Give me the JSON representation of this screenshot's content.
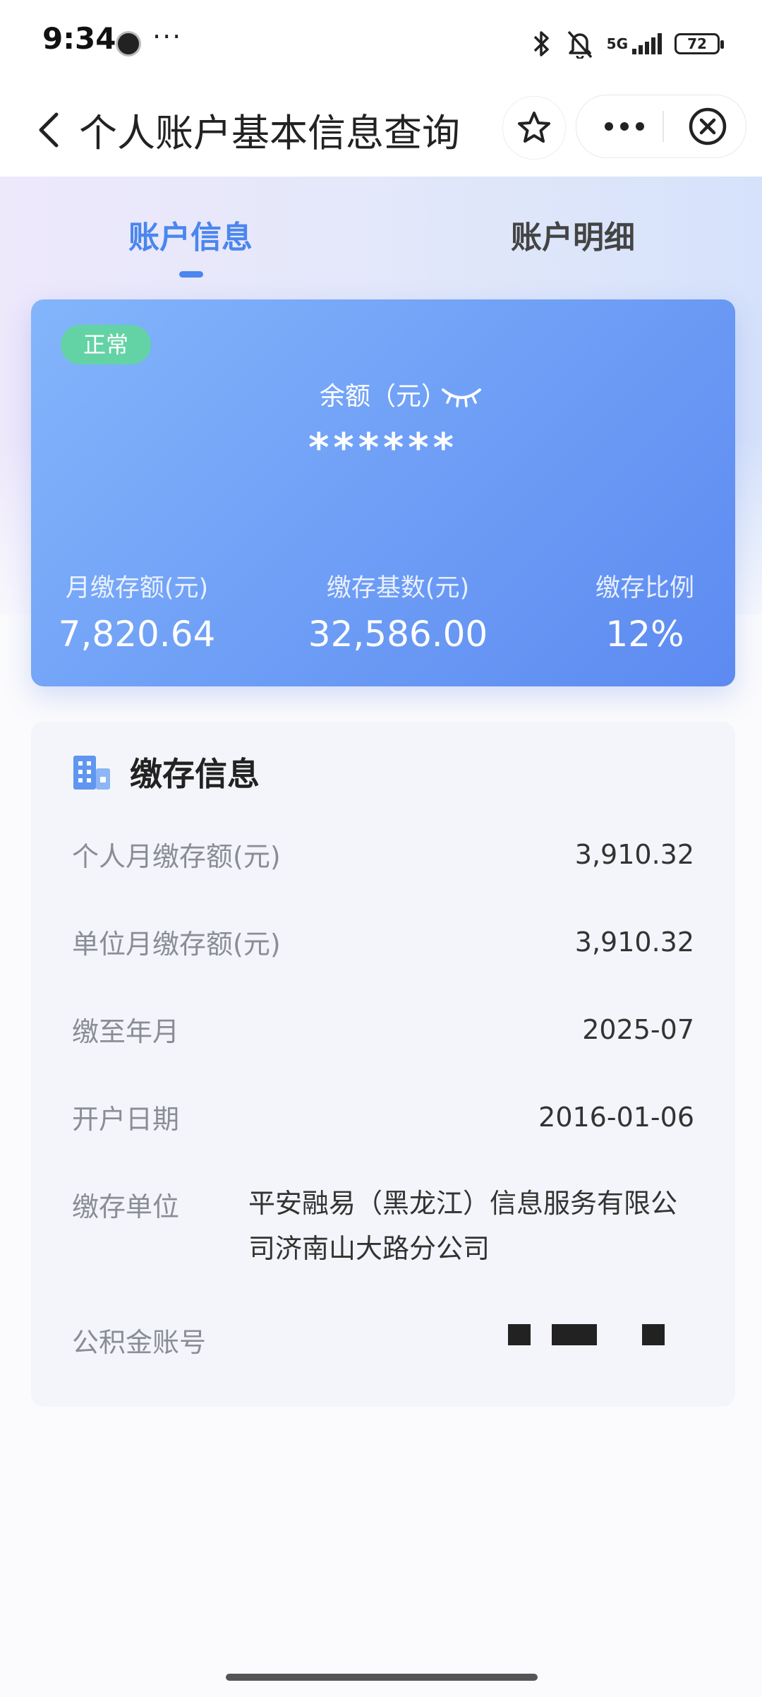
{
  "status_bar": {
    "time": "9:34",
    "more": "···",
    "network": "5G",
    "battery": "72"
  },
  "header": {
    "title": "个人账户基本信息查询"
  },
  "tabs": [
    {
      "label": "账户信息",
      "active": true
    },
    {
      "label": "账户明细",
      "active": false
    }
  ],
  "balance_card": {
    "status": "正常",
    "balance_label": "余额（元）",
    "balance_value": "******",
    "stats": [
      {
        "label": "月缴存额(元)",
        "value": "7,820.64"
      },
      {
        "label": "缴存基数(元)",
        "value": "32,586.00"
      },
      {
        "label": "缴存比例",
        "value": "12%"
      }
    ]
  },
  "contribution_info": {
    "title": "缴存信息",
    "rows": [
      {
        "label": "个人月缴存额(元)",
        "value": "3,910.32"
      },
      {
        "label": "单位月缴存额(元)",
        "value": "3,910.32"
      },
      {
        "label": "缴至年月",
        "value": "2025-07"
      },
      {
        "label": "开户日期",
        "value": "2016-01-06"
      },
      {
        "label": "缴存单位",
        "value": "平安融易（黑龙江）信息服务有限公司济南山大路分公司"
      },
      {
        "label": "公积金账号",
        "value": ""
      }
    ]
  },
  "colors": {
    "accent": "#4a86ee",
    "badge": "#63d3a5",
    "card_start": "#83b5fb",
    "card_end": "#5d8af1"
  }
}
